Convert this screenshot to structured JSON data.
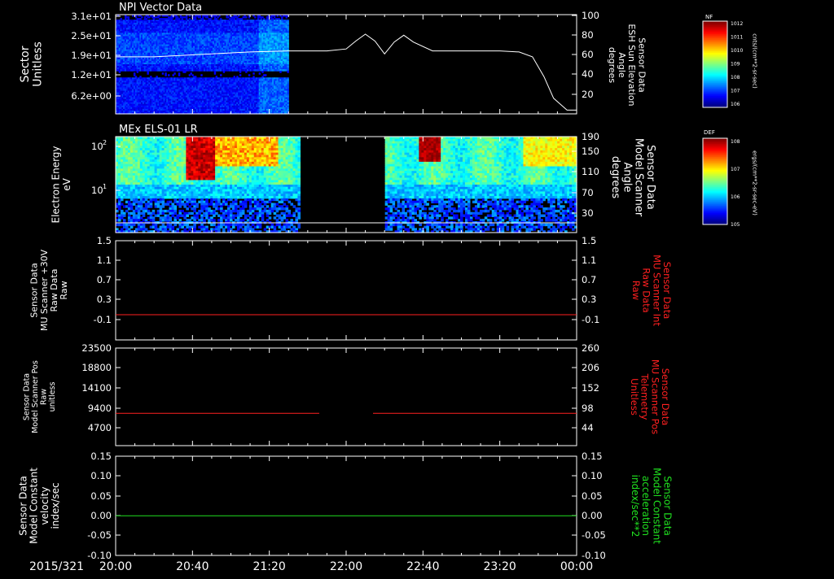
{
  "title": "NPI Vector Data",
  "time_axis": {
    "date_label": "2015/321",
    "ticks": [
      "20:00",
      "20:40",
      "21:20",
      "22:00",
      "22:40",
      "23:20",
      "00:00"
    ],
    "start": "2015-11-17T20:00",
    "end": "2015-11-18T00:00"
  },
  "chart_data": [
    {
      "type": "heatmap",
      "panel": "npi",
      "ylabel": "Sector\nUnitless",
      "yticks": [
        "3.1e+01",
        "2.5e+01",
        "1.9e+01",
        "1.2e+01",
        "6.2e+00"
      ],
      "data_coverage": {
        "start": "20:00",
        "end": "21:30"
      },
      "overlay": {
        "type": "line",
        "name": "Sensor Data ESH Sun Elevation Angle degrees",
        "right_label": "Sensor Data\nESH Sun Elevation\nAngle\ndegrees",
        "right_ticks": [
          "100",
          "80",
          "60",
          "40",
          "20"
        ],
        "ylim": [
          0,
          100
        ],
        "x": [
          "20:00",
          "20:20",
          "20:50",
          "21:10",
          "21:30",
          "21:50",
          "22:00",
          "22:05",
          "22:10",
          "22:15",
          "22:20",
          "22:25",
          "22:30",
          "22:35",
          "22:45",
          "23:00",
          "23:20",
          "23:30",
          "23:37",
          "23:43",
          "23:48",
          "23:55",
          "00:00"
        ],
        "values": [
          58,
          58,
          61,
          63,
          64,
          64,
          66,
          74,
          81,
          74,
          61,
          73,
          80,
          73,
          64,
          64,
          64,
          63,
          58,
          38,
          16,
          4,
          4
        ]
      },
      "colorbar": {
        "label": "NF",
        "unit": "cnts/(cm**2-sr-sec)",
        "ticks": [
          "10^12",
          "10^11",
          "10^10",
          "10^9",
          "10^8",
          "10^7",
          "10^6"
        ]
      }
    },
    {
      "type": "heatmap",
      "panel": "els",
      "title": "MEx ELS-01 LR",
      "ylabel": "Electron Energy\neV",
      "yticks": [
        "10^2",
        "10^1"
      ],
      "data_coverage": [
        {
          "start": "20:00",
          "end": "21:35"
        },
        {
          "start": "22:20",
          "end": "00:00"
        }
      ],
      "overlay": {
        "type": "line",
        "name": "Sensor Data Model Scanner Angle degrees",
        "right_label": "Sensor Data\nModel Scanner\nAngle\ndegrees",
        "right_ticks": [
          "190",
          "150",
          "110",
          "70",
          "30"
        ],
        "ylim": [
          0,
          190
        ],
        "value": 10
      },
      "colorbar": {
        "label": "DEF",
        "unit": "ergs/(cm**2-sr-sec-eV)",
        "ticks": [
          "10^8",
          "10^7",
          "10^6",
          "10^5"
        ]
      }
    },
    {
      "type": "line",
      "panel": "mu-raw",
      "ylabel": "Sensor Data\nMU Scanner +30V\nRaw Data\nRaw",
      "yticks": [
        "1.5",
        "1.1",
        "0.7",
        "0.3",
        "-0.1"
      ],
      "ylim": [
        -0.3,
        1.5
      ],
      "right_label": "Sensor Data\nMU Scanner Int\nRaw Data\nRaw",
      "right_ticks": [
        "1.5",
        "1.1",
        "0.7",
        "0.3",
        "-0.1"
      ],
      "series": [
        {
          "color": "#ff2020",
          "segments": [
            {
              "start": "20:00",
              "end": "00:00",
              "value": 0.0
            }
          ]
        }
      ]
    },
    {
      "type": "line",
      "panel": "mu-pos",
      "ylabel": "Sensor Data\nModel Scanner Pos\nRaw\nunitless",
      "yticks": [
        "23500",
        "18800",
        "14100",
        "9400",
        "4700"
      ],
      "ylim": [
        0,
        23500
      ],
      "right_label": "Sensor Data\nMU Scanner Pos\nTelemetry\nUnitless",
      "right_ticks": [
        "260",
        "206",
        "152",
        "98",
        "44"
      ],
      "series": [
        {
          "color": "#ff2020",
          "segments": [
            {
              "start": "20:00",
              "end": "21:46",
              "value": 8100
            },
            {
              "start": "22:14",
              "end": "00:00",
              "value": 8100
            }
          ]
        }
      ]
    },
    {
      "type": "line",
      "panel": "model-constant",
      "ylabel": "Sensor Data\nModel Constant\nvelocity\nindex/sec",
      "yticks": [
        "0.15",
        "0.10",
        "0.05",
        "0.00",
        "-0.05",
        "-0.10"
      ],
      "ylim": [
        -0.1,
        0.15
      ],
      "right_label": "Sensor Data\nModel Constant\nacceleration\nindex/sec**2",
      "right_ticks": [
        "0.15",
        "0.10",
        "0.05",
        "0.00",
        "-0.05",
        "-0.10"
      ],
      "series": [
        {
          "color": "#20e020",
          "segments": [
            {
              "start": "20:00",
              "end": "00:00",
              "value": 0.0
            }
          ]
        }
      ]
    }
  ],
  "colors": {
    "red_label": "#ff2020",
    "green_label": "#20e020"
  }
}
